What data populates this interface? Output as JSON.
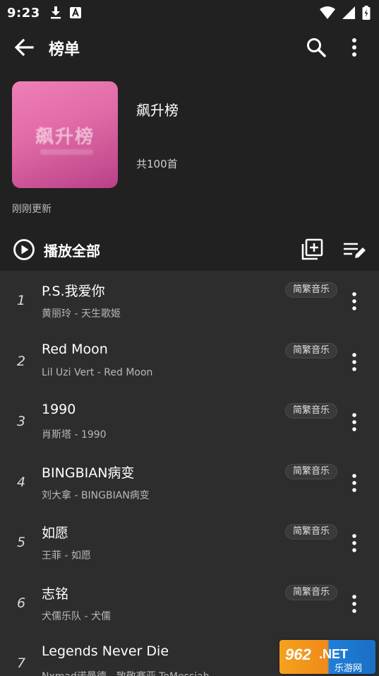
{
  "status_bar": {
    "time": "9:23",
    "left_icons": [
      "download-icon",
      "text-a-icon"
    ],
    "right_icons": [
      "wifi-icon",
      "signal-icon",
      "battery-icon"
    ]
  },
  "app_bar": {
    "title": "榜单",
    "back_icon": "arrow-left-icon",
    "search_icon": "search-icon",
    "more_icon": "more-vert-icon"
  },
  "playlist": {
    "cover_text": "飙升榜",
    "name": "飙升榜",
    "count": "共100首",
    "update_text": "刚刚更新"
  },
  "actions": {
    "play_all_label": "播放全部",
    "play_icon": "play-circle-icon",
    "add_icon": "library-add-icon",
    "edit_icon": "playlist-edit-icon"
  },
  "songs": [
    {
      "index": "1",
      "title": "P.S.我爱你",
      "subtitle": "黄丽玲 - 天生歌姬",
      "tag": "简繁音乐"
    },
    {
      "index": "2",
      "title": "Red Moon",
      "subtitle": "Lil Uzi Vert - Red Moon",
      "tag": "简繁音乐"
    },
    {
      "index": "3",
      "title": "1990",
      "subtitle": "肖斯塔 - 1990",
      "tag": "简繁音乐"
    },
    {
      "index": "4",
      "title": "BINGBIAN病变",
      "subtitle": "刘大拿 - BINGBIAN病变",
      "tag": "简繁音乐"
    },
    {
      "index": "5",
      "title": "如愿",
      "subtitle": "王菲 - 如愿",
      "tag": "简繁音乐"
    },
    {
      "index": "6",
      "title": "志铭",
      "subtitle": "犬儒乐队 - 犬儒",
      "tag": "简繁音乐"
    },
    {
      "index": "7",
      "title": "Legends Never Die",
      "subtitle": "Nxmad诺曼德 - 致敬赛亚 ToMessiah",
      "tag": ""
    }
  ],
  "watermark": {
    "text": "962.NET",
    "subtext": "乐游网"
  },
  "colors": {
    "background": "#212121",
    "list_background": "#2d2d2d",
    "cover_pink": "#e06aa6"
  }
}
